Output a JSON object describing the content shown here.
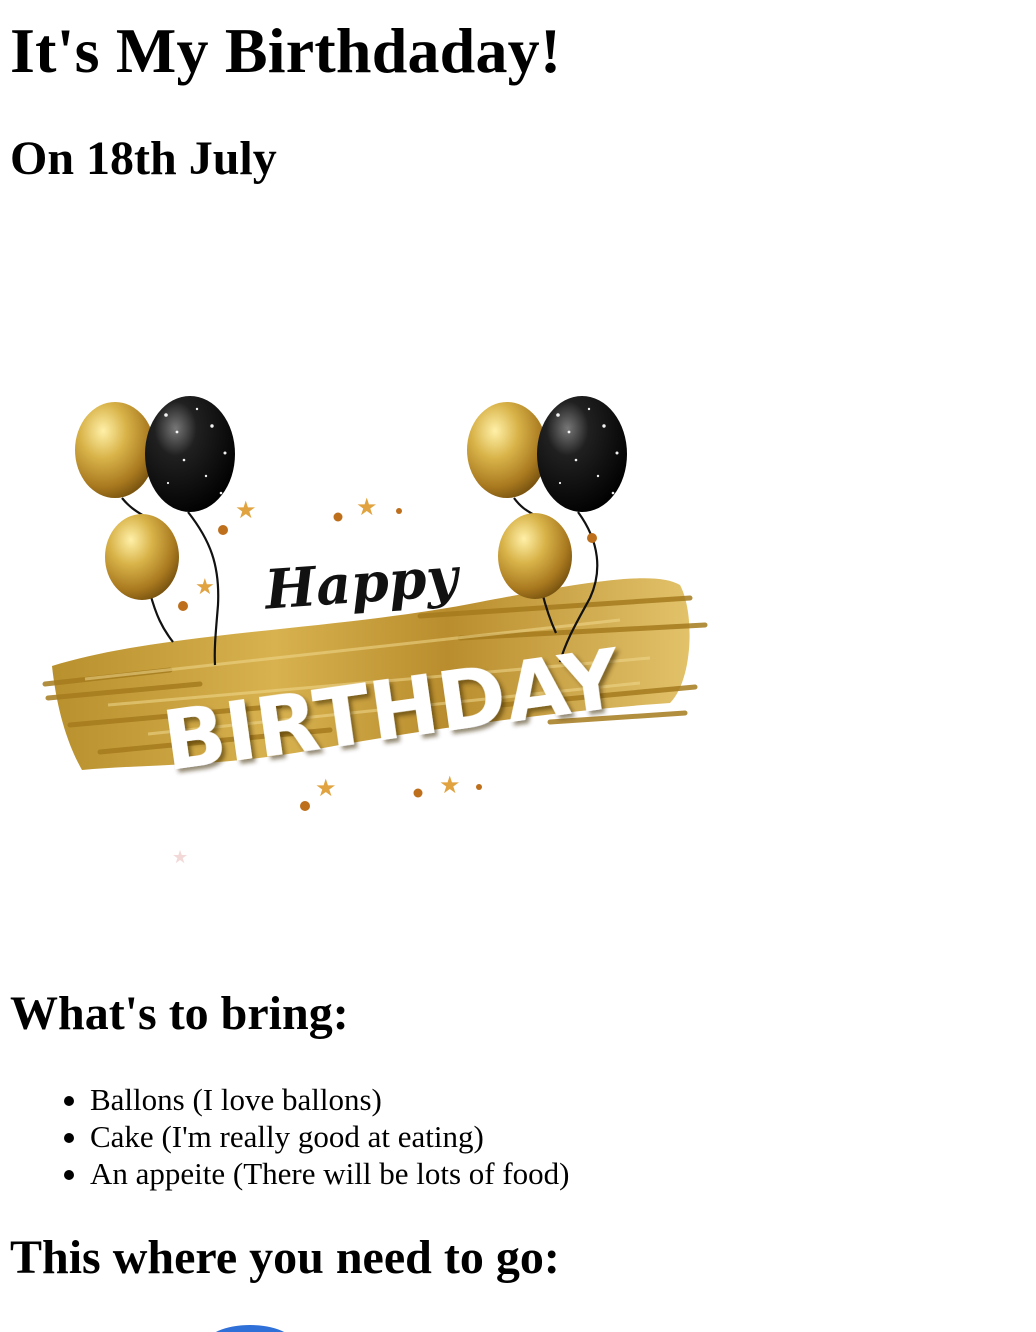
{
  "page": {
    "title": "It's My Birthdaday!",
    "date": "On 18th July"
  },
  "image": {
    "icon": "happy-birthday-banner-image",
    "script_text": "Happy",
    "banner_text": "BIRTHDAY",
    "colors": {
      "gold": "#c8a13b",
      "black_balloon": "#111111"
    }
  },
  "bring": {
    "title": "What's to bring:",
    "items": [
      "Ballons (I love ballons)",
      "Cake (I'm really good at eating)",
      "An appeite (There will be lots of food)"
    ]
  },
  "directions": {
    "title": "This where you need to go:"
  }
}
